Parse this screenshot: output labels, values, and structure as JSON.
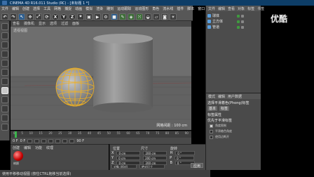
{
  "window": {
    "title": "CINEMA 4D R16.011 Studio (RC) - [未标题 1 *]"
  },
  "menu": {
    "items": [
      "文件",
      "编辑",
      "创建",
      "选择",
      "工具",
      "网格",
      "捕捉",
      "动画",
      "模拟",
      "渲染",
      "雕刻",
      "运动跟踪",
      "运动图形",
      "角色",
      "流水线",
      "插件",
      "脚本",
      "窗口",
      "帮助"
    ]
  },
  "toolbar": {
    "icons": [
      "undo-icon",
      "redo-icon",
      "live-select-icon",
      "move-icon",
      "scale-icon",
      "rotate-icon",
      "x-axis-icon",
      "y-axis-icon",
      "z-axis-icon",
      "coordinate-system-icon",
      "render-view-icon",
      "render-picture-icon",
      "render-settings-icon",
      "cube-icon",
      "pen-icon",
      "subdivision-icon",
      "array-icon",
      "deformer-icon",
      "floor-icon",
      "camera-icon",
      "light-icon"
    ],
    "axis_labels": [
      "X",
      "Y",
      "Z"
    ]
  },
  "viewport": {
    "menu": [
      "查看",
      "摄像机",
      "显示",
      "选项",
      "过滤",
      "面板"
    ],
    "view_label": "透视视图",
    "grid_spacing": "网格间距 : 100 cm"
  },
  "timeline": {
    "ticks": [
      "0",
      "5",
      "10",
      "15",
      "20",
      "25",
      "30",
      "35",
      "40",
      "45",
      "50",
      "55",
      "60",
      "65",
      "70",
      "75",
      "80",
      "85",
      "90"
    ],
    "current_frame": "0 F",
    "start_frame": "0 F",
    "end_frame": "90 F"
  },
  "material_manager": {
    "menu": [
      "创建",
      "编辑",
      "功能",
      "纹理"
    ],
    "material_name": "材质"
  },
  "coordinates": {
    "headers": [
      "位置",
      "尺寸",
      "旋转"
    ],
    "rows": [
      {
        "axis": "X",
        "position": "0 cm",
        "size": "200 cm",
        "rot_axis": "H",
        "rotation": "0 °"
      },
      {
        "axis": "Y",
        "position": "0 cm",
        "size": "200 cm",
        "rot_axis": "P",
        "rotation": "0 °"
      },
      {
        "axis": "Z",
        "position": "0 cm",
        "size": "200 cm",
        "rot_axis": "B",
        "rotation": "0 °"
      }
    ],
    "mode": "对象 (相对)",
    "size_mode": "绝对尺寸",
    "apply_label": "应用"
  },
  "status_bar": {
    "text": "使用平移移动视图 (按住CTRL拖移当前选择)"
  },
  "object_manager": {
    "menu": [
      "文件",
      "编辑",
      "查看",
      "对象",
      "标签",
      "书签"
    ],
    "objects": [
      {
        "name": "球体",
        "icon_color": "#5aa0e0"
      },
      {
        "name": "立方体",
        "icon_color": "#5aa0e0"
      },
      {
        "name": "管道",
        "icon_color": "#5aa0e0"
      }
    ]
  },
  "attribute_manager": {
    "menu": [
      "模式",
      "编辑",
      "用户数据"
    ],
    "title": "选择平滑着色(Phong)标签",
    "tabs": [
      "基本",
      "标签"
    ],
    "section": "标签属性",
    "properties": [
      {
        "label": "角度限制",
        "checked": true
      },
      {
        "label": "平滑着色角度",
        "checked": false
      },
      {
        "label": "使用边断开",
        "checked": false
      }
    ],
    "section2": "优先于平滑标签"
  },
  "watermark": {
    "text": "优酷"
  },
  "colors": {
    "titlebar": "#0d3d67",
    "ui_gray": "#4a4a4a",
    "sphere_selected": "#f0b020",
    "object_gray": "#8a8a8a"
  }
}
